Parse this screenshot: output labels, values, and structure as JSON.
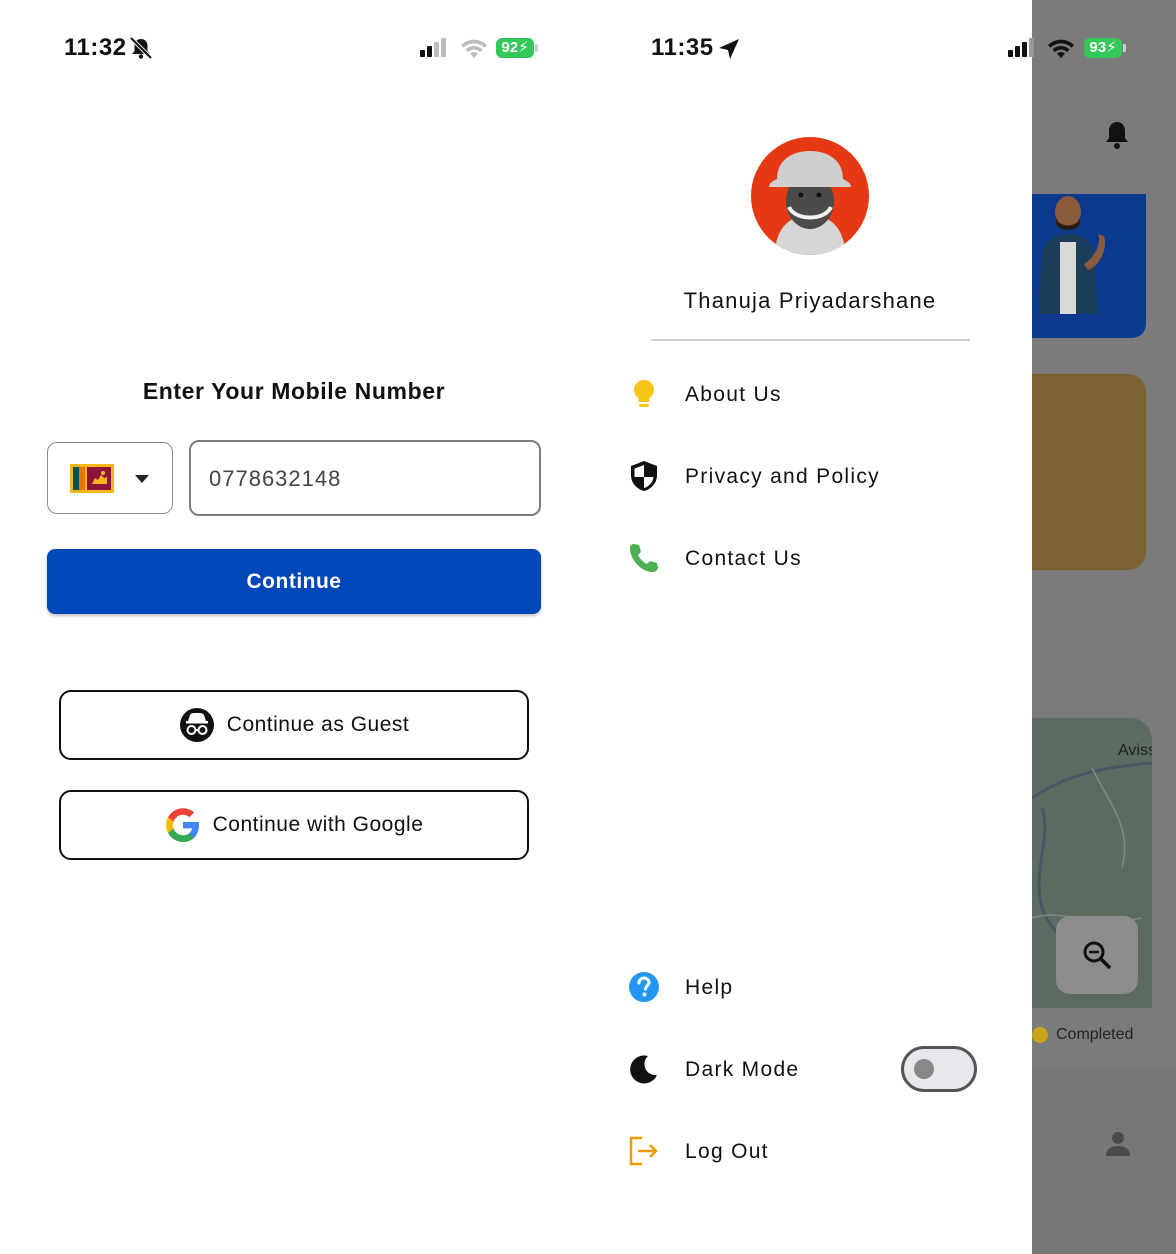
{
  "left_screen": {
    "status_bar": {
      "time": "11:32",
      "battery": "92",
      "icons": [
        "bell-slash-icon",
        "cellular-icon",
        "wifi-icon",
        "battery-icon"
      ]
    },
    "title": "Enter Your Mobile Number",
    "country_selector": {
      "flag": "sri-lanka-flag-icon",
      "caret": "dropdown-caret-icon"
    },
    "phone_field": {
      "value": "0778632148"
    },
    "continue_label": "Continue",
    "guest_label": "Continue as Guest",
    "google_label": "Continue with Google"
  },
  "right_screen": {
    "status_bar": {
      "time": "11:35",
      "battery": "93",
      "icons": [
        "location-arrow-icon",
        "cellular-icon",
        "wifi-icon",
        "battery-icon"
      ]
    },
    "profile": {
      "name": "Thanuja Priyadarshane"
    },
    "menu_top": [
      {
        "label": "About Us",
        "icon": "lightbulb-icon"
      },
      {
        "label": "Privacy and Policy",
        "icon": "shield-icon"
      },
      {
        "label": "Contact Us",
        "icon": "phone-icon"
      }
    ],
    "menu_bottom": [
      {
        "label": "Help",
        "icon": "help-icon"
      },
      {
        "label": "Dark Mode",
        "icon": "moon-icon",
        "toggle": "off"
      },
      {
        "label": "Log Out",
        "icon": "logout-icon"
      }
    ],
    "background": {
      "map_text": "Aviss",
      "legend_completed": "Completed",
      "icons": [
        "bell-icon",
        "zoom-out-icon",
        "person-icon"
      ]
    }
  },
  "colors": {
    "primary_button": "#0047b8",
    "battery_green": "#34c759",
    "overlay": "#7b7b7b",
    "lightbulb": "#f5c518",
    "phone_green": "#4caf50",
    "help_blue": "#2196f3",
    "logout_orange": "#f29900"
  }
}
